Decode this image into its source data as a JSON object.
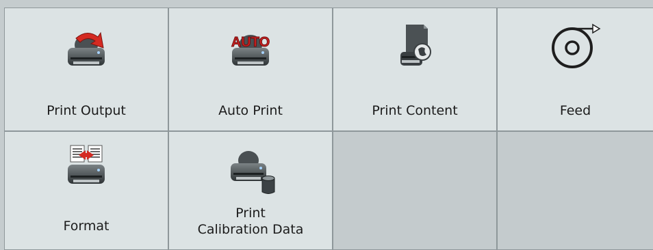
{
  "tiles": [
    {
      "id": "print-output",
      "label": "Print Output",
      "icon": "printer-arrow-icon"
    },
    {
      "id": "auto-print",
      "label": "Auto Print",
      "icon": "printer-auto-icon",
      "badge": "AUTO"
    },
    {
      "id": "print-content",
      "label": "Print Content",
      "icon": "printer-document-globe-icon"
    },
    {
      "id": "feed",
      "label": "Feed",
      "icon": "feed-roll-icon"
    },
    {
      "id": "format",
      "label": "Format",
      "icon": "printer-format-icon"
    },
    {
      "id": "print-calibration-data",
      "label_line1": "Print",
      "label_line2": "Calibration Data",
      "icon": "printer-database-icon"
    }
  ],
  "colors": {
    "tile_bg": "#dce3e4",
    "empty_tile_bg": "#c4cbcd",
    "border": "#8e979a",
    "accent_red": "#cc2222"
  }
}
